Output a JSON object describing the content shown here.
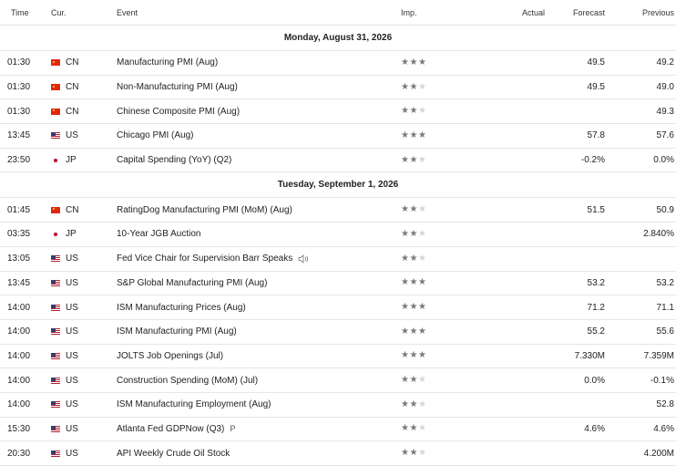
{
  "header": {
    "time": "Time",
    "currency": "Cur.",
    "event": "Event",
    "importance": "Imp.",
    "actual": "Actual",
    "forecast": "Forecast",
    "previous": "Previous"
  },
  "icons": {
    "flag_cn": "flag-china-icon",
    "flag_us": "flag-usa-icon",
    "flag_jp": "flag-japan-icon",
    "star": "star-icon",
    "speaker": "speaker-icon"
  },
  "colors": {
    "star_on": "#7a7a7a",
    "star_off": "#d5d5d5",
    "row_border": "#e6e6e6"
  },
  "days": [
    {
      "label": "Monday, August 31, 2026",
      "events": [
        {
          "time": "01:30",
          "currency": "CN",
          "event": "Manufacturing PMI  (Aug)",
          "stars": 3,
          "actual": "",
          "forecast": "49.5",
          "previous": "49.2"
        },
        {
          "time": "01:30",
          "currency": "CN",
          "event": "Non-Manufacturing PMI  (Aug)",
          "stars": 2,
          "actual": "",
          "forecast": "49.5",
          "previous": "49.0"
        },
        {
          "time": "01:30",
          "currency": "CN",
          "event": "Chinese Composite PMI  (Aug)",
          "stars": 2,
          "actual": "",
          "forecast": "",
          "previous": "49.3"
        },
        {
          "time": "13:45",
          "currency": "US",
          "event": "Chicago PMI  (Aug)",
          "stars": 3,
          "actual": "",
          "forecast": "57.8",
          "previous": "57.6"
        },
        {
          "time": "23:50",
          "currency": "JP",
          "event": "Capital Spending (YoY)  (Q2)",
          "stars": 2,
          "actual": "",
          "forecast": "-0.2%",
          "previous": "0.0%"
        }
      ]
    },
    {
      "label": "Tuesday, September 1, 2026",
      "events": [
        {
          "time": "01:45",
          "currency": "CN",
          "event": "RatingDog Manufacturing PMI (MoM)  (Aug)",
          "stars": 2,
          "actual": "",
          "forecast": "51.5",
          "previous": "50.9"
        },
        {
          "time": "03:35",
          "currency": "JP",
          "event": "10-Year JGB Auction",
          "stars": 2,
          "actual": "",
          "forecast": "",
          "previous": "2.840%"
        },
        {
          "time": "13:05",
          "currency": "US",
          "event": "Fed Vice Chair for Supervision Barr Speaks",
          "stars": 2,
          "actual": "",
          "forecast": "",
          "previous": "",
          "speaker": true
        },
        {
          "time": "13:45",
          "currency": "US",
          "event": "S&P Global Manufacturing PMI  (Aug)",
          "stars": 3,
          "actual": "",
          "forecast": "53.2",
          "previous": "53.2"
        },
        {
          "time": "14:00",
          "currency": "US",
          "event": "ISM Manufacturing Prices  (Aug)",
          "stars": 3,
          "actual": "",
          "forecast": "71.2",
          "previous": "71.1"
        },
        {
          "time": "14:00",
          "currency": "US",
          "event": "ISM Manufacturing PMI  (Aug)",
          "stars": 3,
          "actual": "",
          "forecast": "55.2",
          "previous": "55.6"
        },
        {
          "time": "14:00",
          "currency": "US",
          "event": "JOLTS Job Openings  (Jul)",
          "stars": 3,
          "actual": "",
          "forecast": "7.330M",
          "previous": "7.359M"
        },
        {
          "time": "14:00",
          "currency": "US",
          "event": "Construction Spending (MoM)  (Jul)",
          "stars": 2,
          "actual": "",
          "forecast": "0.0%",
          "previous": "-0.1%"
        },
        {
          "time": "14:00",
          "currency": "US",
          "event": "ISM Manufacturing Employment  (Aug)",
          "stars": 2,
          "actual": "",
          "forecast": "",
          "previous": "52.8"
        },
        {
          "time": "15:30",
          "currency": "US",
          "event": "Atlanta Fed GDPNow  (Q3)",
          "stars": 2,
          "actual": "",
          "forecast": "4.6%",
          "previous": "4.6%",
          "tag": "P"
        },
        {
          "time": "20:30",
          "currency": "US",
          "event": "API Weekly Crude Oil Stock",
          "stars": 2,
          "actual": "",
          "forecast": "",
          "previous": "4.200M"
        }
      ]
    }
  ]
}
